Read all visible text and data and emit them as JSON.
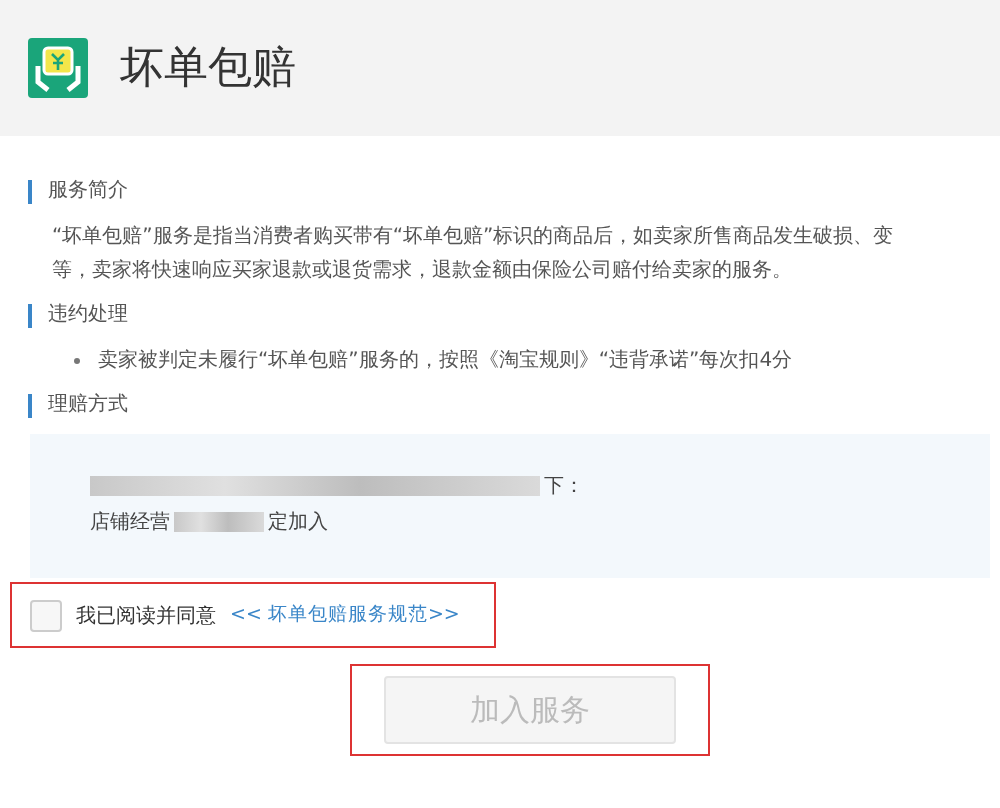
{
  "header": {
    "title": "坏单包赔"
  },
  "sections": [
    {
      "kind": "paragraph",
      "heading": "服务简介",
      "lines": [
        "“坏单包赔”服务是指当消费者购买带有“坏单包赔”标识的商品后，如卖家所售商品发生破损、变",
        "等，卖家将快速响应买家退款或退货需求，退款金额由保险公司赔付给卖家的服务。"
      ]
    },
    {
      "kind": "bullets",
      "heading": "违约处理",
      "lines": [
        "卖家被判定未履行“坏单包赔”服务的，按照《淘宝规则》“违背承诺”每次扣4分"
      ]
    },
    {
      "kind": "panel",
      "heading": "理赔方式",
      "lines": [
        "下：",
        "店铺经营",
        "定加入"
      ]
    }
  ],
  "agreement": {
    "checked": false,
    "label": "我已阅读并同意",
    "link": "<< 坏单包赔服务规范>>"
  },
  "join_button": {
    "label": "加入服务",
    "disabled": true
  }
}
